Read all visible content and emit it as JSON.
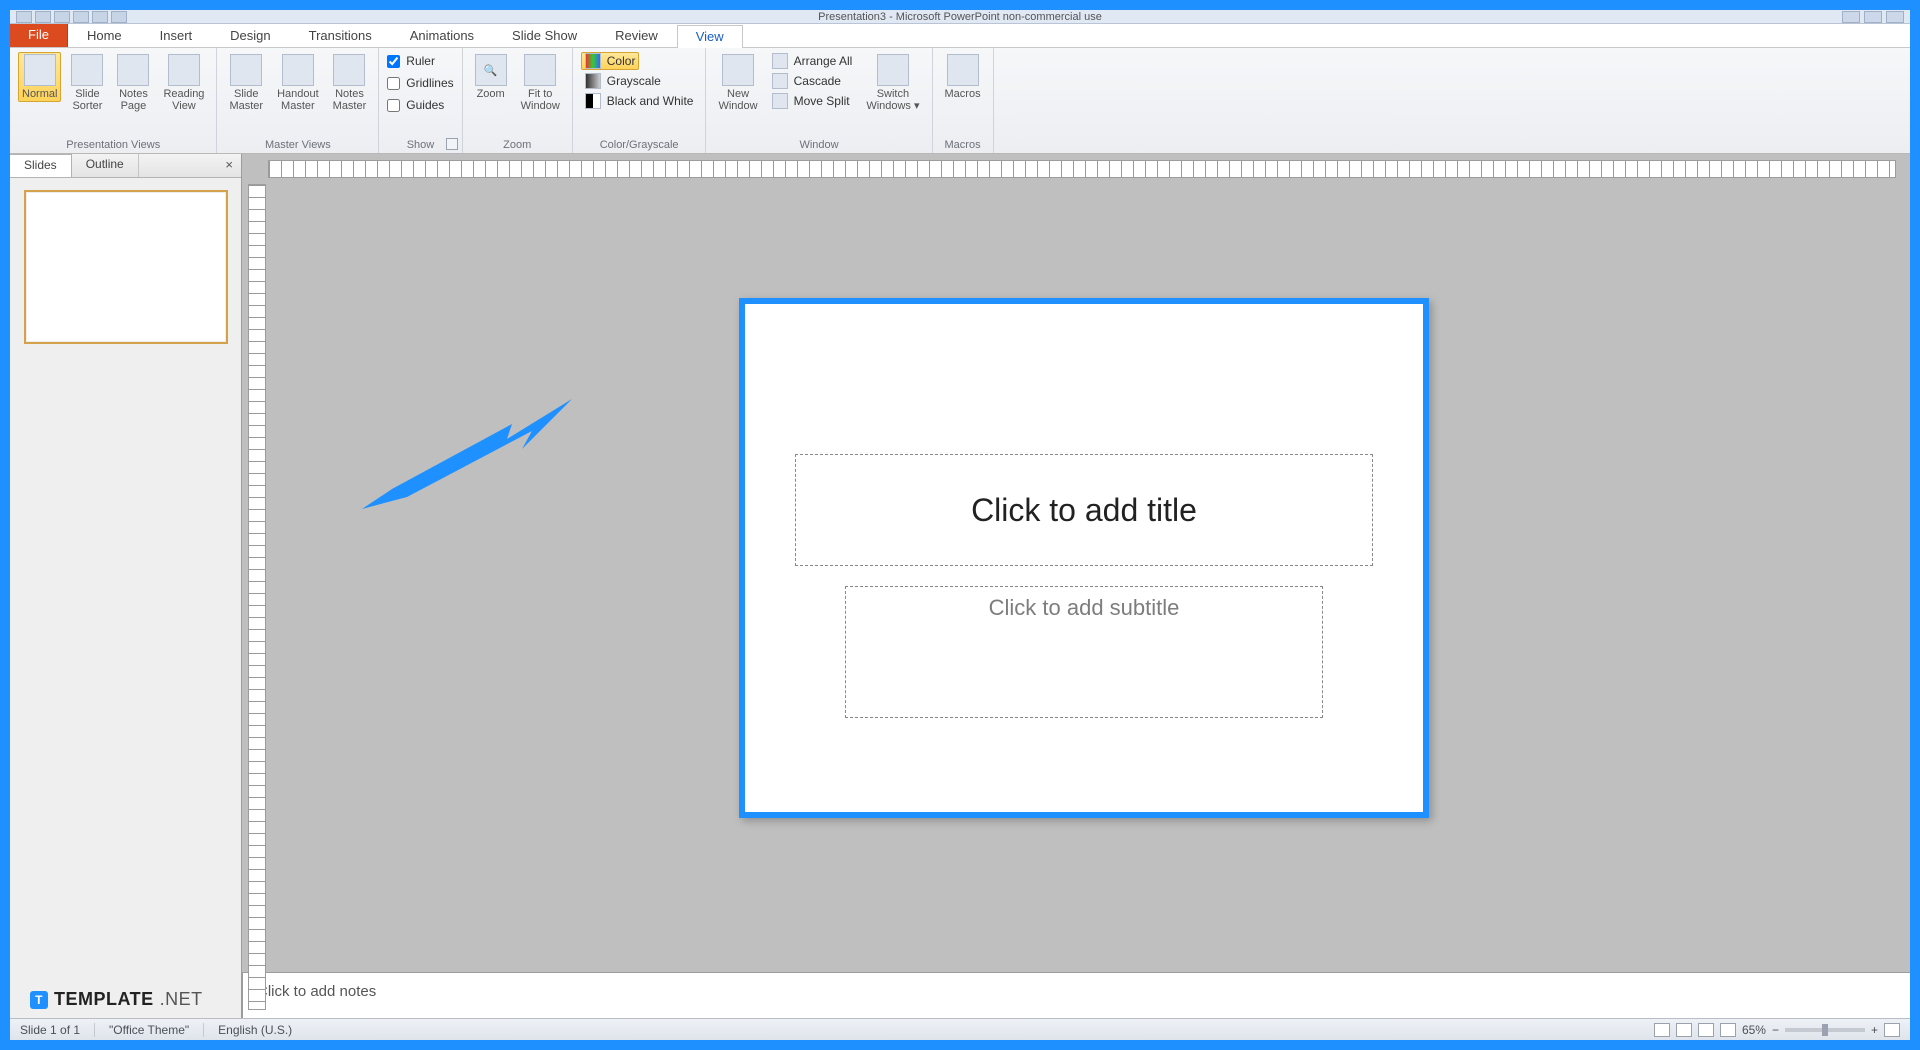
{
  "title": "Presentation3 - Microsoft PowerPoint non-commercial use",
  "menu": {
    "file": "File",
    "tabs": [
      "Home",
      "Insert",
      "Design",
      "Transitions",
      "Animations",
      "Slide Show",
      "Review",
      "View"
    ],
    "active": "View"
  },
  "ribbon": {
    "presentation_views": {
      "label": "Presentation Views",
      "normal": "Normal",
      "slide_sorter": "Slide\nSorter",
      "notes_page": "Notes\nPage",
      "reading_view": "Reading\nView"
    },
    "master_views": {
      "label": "Master Views",
      "slide_master": "Slide\nMaster",
      "handout_master": "Handout\nMaster",
      "notes_master": "Notes\nMaster"
    },
    "show": {
      "label": "Show",
      "ruler": "Ruler",
      "gridlines": "Gridlines",
      "guides": "Guides"
    },
    "zoom": {
      "label": "Zoom",
      "zoom": "Zoom",
      "fit": "Fit to\nWindow"
    },
    "color_grayscale": {
      "label": "Color/Grayscale",
      "color": "Color",
      "grayscale": "Grayscale",
      "bw": "Black and White"
    },
    "window": {
      "label": "Window",
      "new_window": "New\nWindow",
      "arrange_all": "Arrange All",
      "cascade": "Cascade",
      "move_split": "Move Split",
      "switch": "Switch\nWindows ▾"
    },
    "macros": {
      "label": "Macros",
      "macros": "Macros"
    }
  },
  "left_panel": {
    "slides_tab": "Slides",
    "outline_tab": "Outline",
    "close": "×"
  },
  "slide": {
    "title_placeholder": "Click to add title",
    "subtitle_placeholder": "Click to add subtitle"
  },
  "notes": {
    "placeholder": "Click to add notes"
  },
  "status": {
    "slide": "Slide 1 of 1",
    "theme": "\"Office Theme\"",
    "lang": "English (U.S.)",
    "zoom": "65%"
  },
  "watermark": {
    "brand": "TEMPLATE",
    "suffix": ".NET"
  }
}
